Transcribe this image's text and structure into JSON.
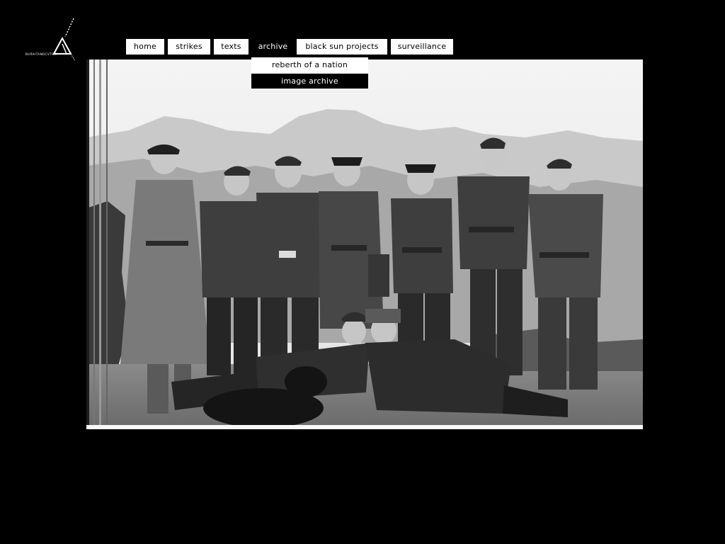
{
  "logo": {
    "icon": "triangle-logo-icon",
    "caption": "BURAITANDCVTOR"
  },
  "nav": {
    "items": [
      {
        "label": "home",
        "active": false
      },
      {
        "label": "strikes",
        "active": false
      },
      {
        "label": "texts",
        "active": false
      },
      {
        "label": "archive",
        "active": true
      },
      {
        "label": "black sun projects",
        "active": false
      },
      {
        "label": "surveillance",
        "active": false
      }
    ]
  },
  "dropdown": {
    "items": [
      {
        "label": "reberth of a nation"
      },
      {
        "label": "image archive"
      }
    ]
  },
  "photo": {
    "description_icon": "black-and-white-group-photo"
  },
  "colors": {
    "background": "#000000",
    "nav_bg": "#ffffff",
    "nav_active_bg": "#000000"
  }
}
